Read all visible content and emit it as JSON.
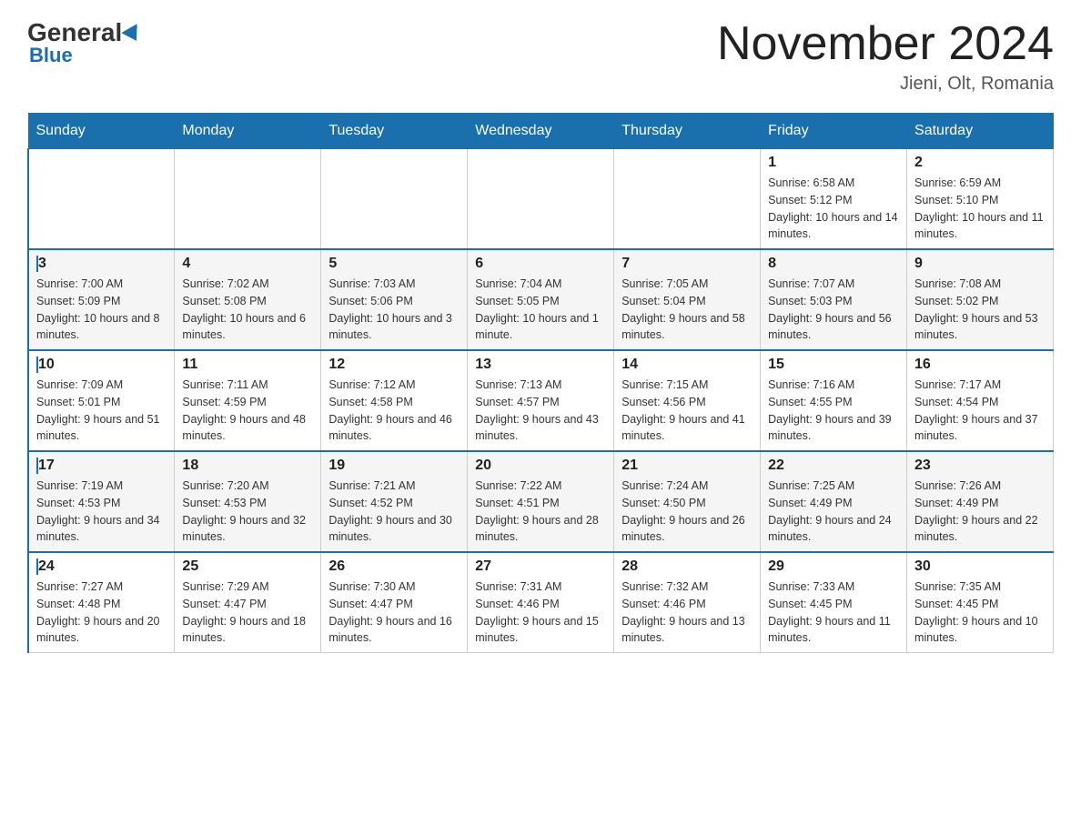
{
  "header": {
    "logo": {
      "general": "General",
      "blue": "Blue"
    },
    "title": "November 2024",
    "location": "Jieni, Olt, Romania"
  },
  "days_of_week": [
    "Sunday",
    "Monday",
    "Tuesday",
    "Wednesday",
    "Thursday",
    "Friday",
    "Saturday"
  ],
  "weeks": [
    [
      {
        "day": "",
        "sunrise": "",
        "sunset": "",
        "daylight": ""
      },
      {
        "day": "",
        "sunrise": "",
        "sunset": "",
        "daylight": ""
      },
      {
        "day": "",
        "sunrise": "",
        "sunset": "",
        "daylight": ""
      },
      {
        "day": "",
        "sunrise": "",
        "sunset": "",
        "daylight": ""
      },
      {
        "day": "",
        "sunrise": "",
        "sunset": "",
        "daylight": ""
      },
      {
        "day": "1",
        "sunrise": "Sunrise: 6:58 AM",
        "sunset": "Sunset: 5:12 PM",
        "daylight": "Daylight: 10 hours and 14 minutes."
      },
      {
        "day": "2",
        "sunrise": "Sunrise: 6:59 AM",
        "sunset": "Sunset: 5:10 PM",
        "daylight": "Daylight: 10 hours and 11 minutes."
      }
    ],
    [
      {
        "day": "3",
        "sunrise": "Sunrise: 7:00 AM",
        "sunset": "Sunset: 5:09 PM",
        "daylight": "Daylight: 10 hours and 8 minutes."
      },
      {
        "day": "4",
        "sunrise": "Sunrise: 7:02 AM",
        "sunset": "Sunset: 5:08 PM",
        "daylight": "Daylight: 10 hours and 6 minutes."
      },
      {
        "day": "5",
        "sunrise": "Sunrise: 7:03 AM",
        "sunset": "Sunset: 5:06 PM",
        "daylight": "Daylight: 10 hours and 3 minutes."
      },
      {
        "day": "6",
        "sunrise": "Sunrise: 7:04 AM",
        "sunset": "Sunset: 5:05 PM",
        "daylight": "Daylight: 10 hours and 1 minute."
      },
      {
        "day": "7",
        "sunrise": "Sunrise: 7:05 AM",
        "sunset": "Sunset: 5:04 PM",
        "daylight": "Daylight: 9 hours and 58 minutes."
      },
      {
        "day": "8",
        "sunrise": "Sunrise: 7:07 AM",
        "sunset": "Sunset: 5:03 PM",
        "daylight": "Daylight: 9 hours and 56 minutes."
      },
      {
        "day": "9",
        "sunrise": "Sunrise: 7:08 AM",
        "sunset": "Sunset: 5:02 PM",
        "daylight": "Daylight: 9 hours and 53 minutes."
      }
    ],
    [
      {
        "day": "10",
        "sunrise": "Sunrise: 7:09 AM",
        "sunset": "Sunset: 5:01 PM",
        "daylight": "Daylight: 9 hours and 51 minutes."
      },
      {
        "day": "11",
        "sunrise": "Sunrise: 7:11 AM",
        "sunset": "Sunset: 4:59 PM",
        "daylight": "Daylight: 9 hours and 48 minutes."
      },
      {
        "day": "12",
        "sunrise": "Sunrise: 7:12 AM",
        "sunset": "Sunset: 4:58 PM",
        "daylight": "Daylight: 9 hours and 46 minutes."
      },
      {
        "day": "13",
        "sunrise": "Sunrise: 7:13 AM",
        "sunset": "Sunset: 4:57 PM",
        "daylight": "Daylight: 9 hours and 43 minutes."
      },
      {
        "day": "14",
        "sunrise": "Sunrise: 7:15 AM",
        "sunset": "Sunset: 4:56 PM",
        "daylight": "Daylight: 9 hours and 41 minutes."
      },
      {
        "day": "15",
        "sunrise": "Sunrise: 7:16 AM",
        "sunset": "Sunset: 4:55 PM",
        "daylight": "Daylight: 9 hours and 39 minutes."
      },
      {
        "day": "16",
        "sunrise": "Sunrise: 7:17 AM",
        "sunset": "Sunset: 4:54 PM",
        "daylight": "Daylight: 9 hours and 37 minutes."
      }
    ],
    [
      {
        "day": "17",
        "sunrise": "Sunrise: 7:19 AM",
        "sunset": "Sunset: 4:53 PM",
        "daylight": "Daylight: 9 hours and 34 minutes."
      },
      {
        "day": "18",
        "sunrise": "Sunrise: 7:20 AM",
        "sunset": "Sunset: 4:53 PM",
        "daylight": "Daylight: 9 hours and 32 minutes."
      },
      {
        "day": "19",
        "sunrise": "Sunrise: 7:21 AM",
        "sunset": "Sunset: 4:52 PM",
        "daylight": "Daylight: 9 hours and 30 minutes."
      },
      {
        "day": "20",
        "sunrise": "Sunrise: 7:22 AM",
        "sunset": "Sunset: 4:51 PM",
        "daylight": "Daylight: 9 hours and 28 minutes."
      },
      {
        "day": "21",
        "sunrise": "Sunrise: 7:24 AM",
        "sunset": "Sunset: 4:50 PM",
        "daylight": "Daylight: 9 hours and 26 minutes."
      },
      {
        "day": "22",
        "sunrise": "Sunrise: 7:25 AM",
        "sunset": "Sunset: 4:49 PM",
        "daylight": "Daylight: 9 hours and 24 minutes."
      },
      {
        "day": "23",
        "sunrise": "Sunrise: 7:26 AM",
        "sunset": "Sunset: 4:49 PM",
        "daylight": "Daylight: 9 hours and 22 minutes."
      }
    ],
    [
      {
        "day": "24",
        "sunrise": "Sunrise: 7:27 AM",
        "sunset": "Sunset: 4:48 PM",
        "daylight": "Daylight: 9 hours and 20 minutes."
      },
      {
        "day": "25",
        "sunrise": "Sunrise: 7:29 AM",
        "sunset": "Sunset: 4:47 PM",
        "daylight": "Daylight: 9 hours and 18 minutes."
      },
      {
        "day": "26",
        "sunrise": "Sunrise: 7:30 AM",
        "sunset": "Sunset: 4:47 PM",
        "daylight": "Daylight: 9 hours and 16 minutes."
      },
      {
        "day": "27",
        "sunrise": "Sunrise: 7:31 AM",
        "sunset": "Sunset: 4:46 PM",
        "daylight": "Daylight: 9 hours and 15 minutes."
      },
      {
        "day": "28",
        "sunrise": "Sunrise: 7:32 AM",
        "sunset": "Sunset: 4:46 PM",
        "daylight": "Daylight: 9 hours and 13 minutes."
      },
      {
        "day": "29",
        "sunrise": "Sunrise: 7:33 AM",
        "sunset": "Sunset: 4:45 PM",
        "daylight": "Daylight: 9 hours and 11 minutes."
      },
      {
        "day": "30",
        "sunrise": "Sunrise: 7:35 AM",
        "sunset": "Sunset: 4:45 PM",
        "daylight": "Daylight: 9 hours and 10 minutes."
      }
    ]
  ]
}
